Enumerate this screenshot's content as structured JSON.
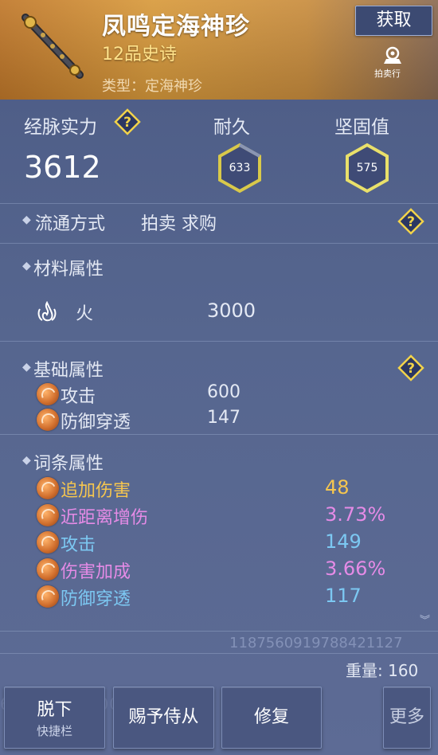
{
  "header": {
    "item_name": "凤鸣定海神珍",
    "grade": "12品史诗",
    "type": "类型：定海神珍",
    "get_button": "获取",
    "auction_label": "拍卖行"
  },
  "stats": {
    "power_label": "经脉实力",
    "power_value": "3612",
    "durability_label": "耐久",
    "durability_value": "633",
    "firmness_label": "坚固值",
    "firmness_value": "575"
  },
  "circulation": {
    "label": "流通方式",
    "value": "拍卖 求购"
  },
  "material": {
    "title": "材料属性",
    "element_label": "火",
    "element_value": "3000"
  },
  "basic": {
    "title": "基础属性",
    "rows": [
      {
        "label": "攻击",
        "value": "600"
      },
      {
        "label": "防御穿透",
        "value": "147"
      }
    ]
  },
  "affix": {
    "title": "词条属性",
    "rows": [
      {
        "label": "追加伤害",
        "value": "48",
        "color": "#f5c64f"
      },
      {
        "label": "近距离增伤",
        "value": "3.73%",
        "color": "#e58be6"
      },
      {
        "label": "攻击",
        "value": "149",
        "color": "#7cc8f2"
      },
      {
        "label": "伤害加成",
        "value": "3.66%",
        "color": "#e58be6"
      },
      {
        "label": "防御穿透",
        "value": "117",
        "color": "#7cc8f2"
      }
    ]
  },
  "footer": {
    "item_id": "1187560919788421127",
    "weight": "重量: 160",
    "bg_id": "674962431000745"
  },
  "buttons": {
    "unequip": "脱下",
    "unequip_sub": "快捷栏",
    "gift": "赐予侍从",
    "repair": "修复",
    "more": "更多"
  }
}
